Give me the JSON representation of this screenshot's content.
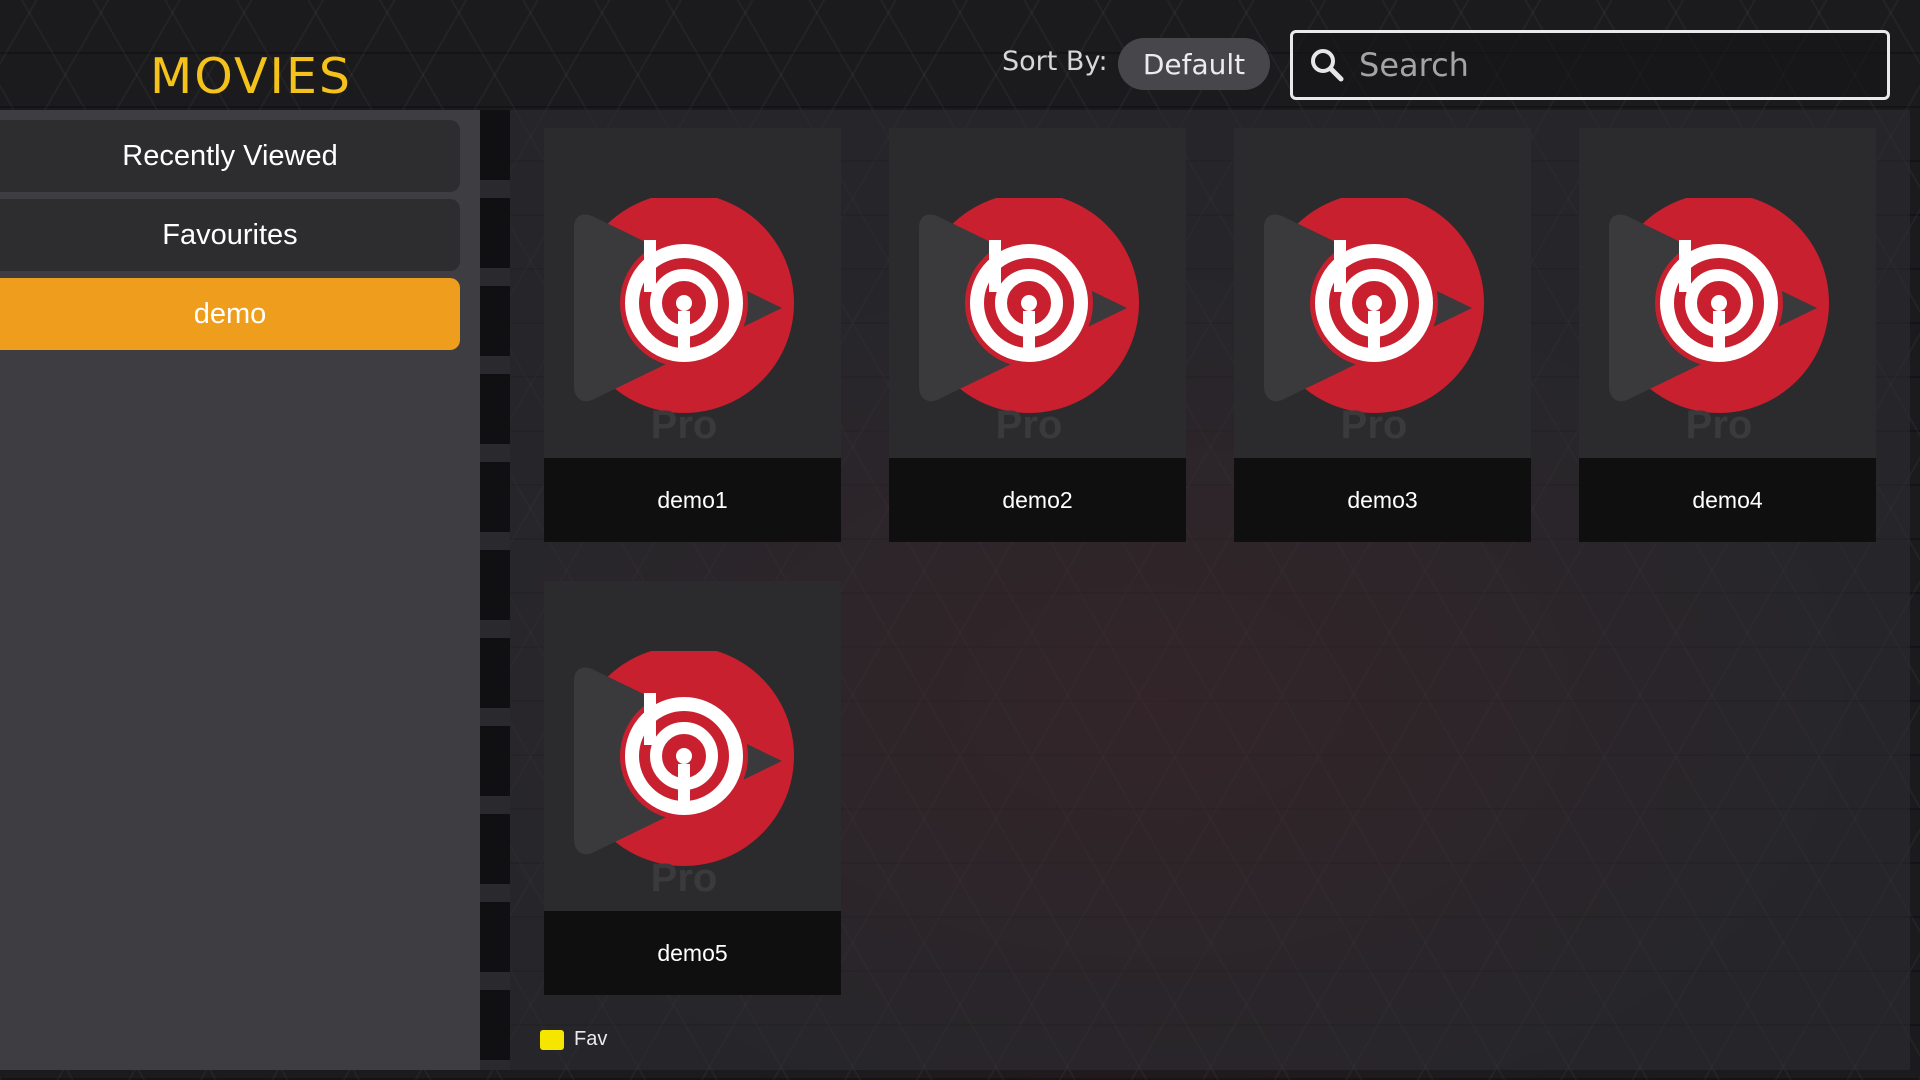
{
  "header": {
    "title": "MOVIES",
    "sort_label": "Sort By:",
    "sort_value": "Default",
    "search_placeholder": "Search"
  },
  "sidebar": {
    "items": [
      {
        "label": "Recently Viewed",
        "active": false
      },
      {
        "label": "Favourites",
        "active": false
      },
      {
        "label": "demo",
        "active": true
      }
    ]
  },
  "movies": [
    {
      "title": "demo1",
      "poster_icon": "app-logo-icon",
      "poster_text": "Pro"
    },
    {
      "title": "demo2",
      "poster_icon": "app-logo-icon",
      "poster_text": "Pro"
    },
    {
      "title": "demo3",
      "poster_icon": "app-logo-icon",
      "poster_text": "Pro"
    },
    {
      "title": "demo4",
      "poster_icon": "app-logo-icon",
      "poster_text": "Pro"
    },
    {
      "title": "demo5",
      "poster_icon": "app-logo-icon",
      "poster_text": "Pro"
    }
  ],
  "legend": {
    "label": "Fav",
    "color": "#f5e600"
  },
  "colors": {
    "title": "#f4c21b",
    "active_item": "#ef9d1c",
    "logo_red": "#c8202f",
    "logo_dark": "#3a3a3c"
  }
}
